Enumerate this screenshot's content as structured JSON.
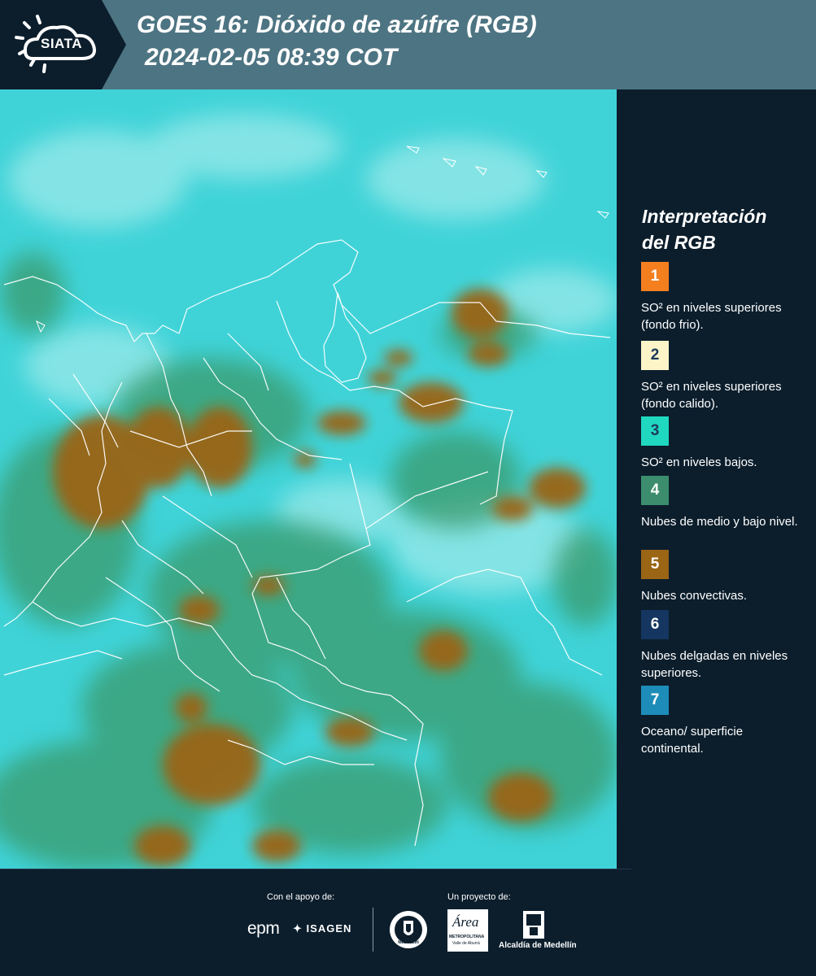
{
  "header": {
    "logo_text": "SIATA",
    "title_line1": "GOES 16: Dióxido de azúfre (RGB)",
    "title_line2": "2024-02-05 08:39 COT"
  },
  "legend": {
    "title_line1": "Interpretación",
    "title_line2": "del RGB",
    "items": [
      {
        "number": "1",
        "color": "#f47f1f",
        "label": "SO² en niveles superiores (fondo frio)."
      },
      {
        "number": "2",
        "color": "#fdf5c8",
        "label": "SO² en niveles superiores (fondo calido)."
      },
      {
        "number": "3",
        "color": "#20d7c0",
        "label": "SO² en niveles bajos."
      },
      {
        "number": "4",
        "color": "#3b8d6d",
        "label": "Nubes de medio y bajo nivel."
      },
      {
        "number": "5",
        "color": "#9a6514",
        "label": "Nubes convectivas."
      },
      {
        "number": "6",
        "color": "#143660",
        "label": "Nubes delgadas en niveles superiores."
      },
      {
        "number": "7",
        "color": "#1d8cb8",
        "label": "Oceano/ superficie continental."
      }
    ]
  },
  "footer": {
    "support_label": "Con el apoyo de:",
    "project_label": "Un proyecto de:",
    "logo_epm": "epm",
    "logo_isagen": "ISAGEN",
    "logo_area": "Área",
    "logo_area_sub": "METROPOLITANA",
    "logo_area_sub2": "Valle de Aburrá",
    "logo_medellin": "MEDELLÍN",
    "logo_alcaldia": "Alcaldía de Medellín"
  },
  "colors": {
    "ocean_cyan": "#3fd3d8",
    "cloud_green": "#3a9a6a",
    "convective_brown": "#9a6514",
    "border": "#ffffff"
  }
}
